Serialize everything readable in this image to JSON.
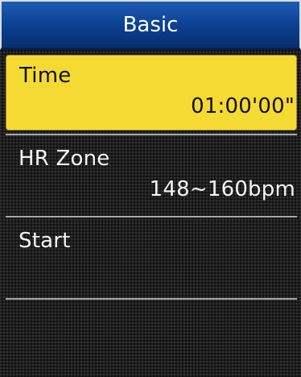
{
  "header": {
    "title": "Basic"
  },
  "menu": {
    "items": [
      {
        "label": "Time",
        "value": "01:00'00\"",
        "selected": true
      },
      {
        "label": "HR Zone",
        "value": "148~160bpm",
        "selected": false
      },
      {
        "label": "Start",
        "value": "",
        "selected": false
      }
    ]
  },
  "colors": {
    "header_blue": "#0b3f8f",
    "highlight_yellow": "#f5da34",
    "background": "#1e1e1e"
  }
}
